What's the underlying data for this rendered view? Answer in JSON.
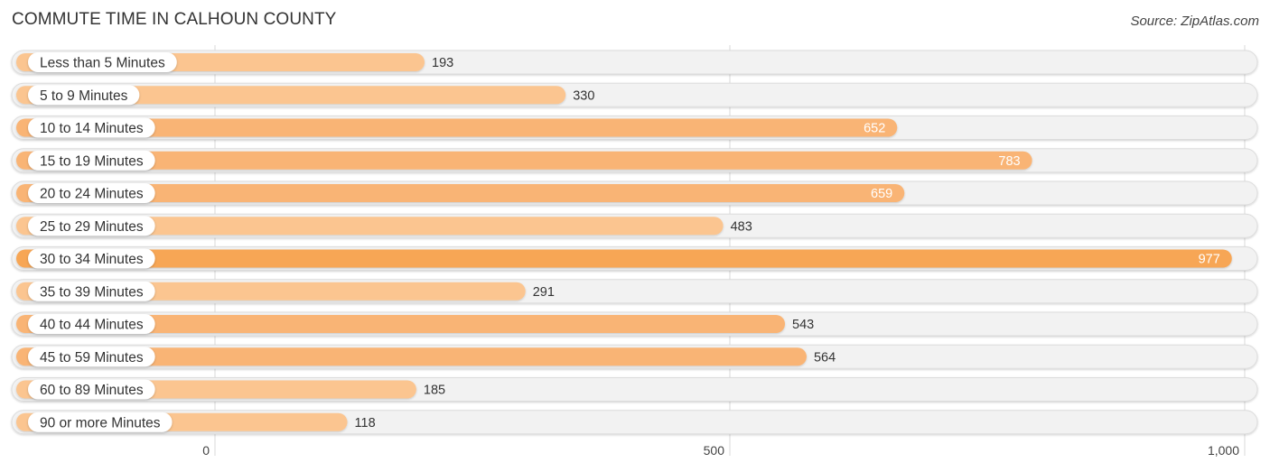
{
  "header": {
    "title": "COMMUTE TIME IN CALHOUN COUNTY",
    "source": "Source: ZipAtlas.com"
  },
  "colors": {
    "bar_light": "#fbc590",
    "bar_mid": "#f9b474",
    "bar_dark": "#f7a654",
    "track": "#f2f2f2",
    "grid": "#d8d8d8"
  },
  "chart_data": {
    "type": "bar",
    "orientation": "horizontal",
    "title": "COMMUTE TIME IN CALHOUN COUNTY",
    "xlabel": "",
    "ylabel": "",
    "categories": [
      "Less than 5 Minutes",
      "5 to 9 Minutes",
      "10 to 14 Minutes",
      "15 to 19 Minutes",
      "20 to 24 Minutes",
      "25 to 29 Minutes",
      "30 to 34 Minutes",
      "35 to 39 Minutes",
      "40 to 44 Minutes",
      "45 to 59 Minutes",
      "60 to 89 Minutes",
      "90 or more Minutes"
    ],
    "values": [
      193,
      330,
      652,
      783,
      659,
      483,
      977,
      291,
      543,
      564,
      185,
      118
    ],
    "value_labels": [
      "193",
      "330",
      "652",
      "783",
      "659",
      "483",
      "977",
      "291",
      "543",
      "564",
      "185",
      "118"
    ],
    "xlim": [
      0,
      1000
    ],
    "ticks": [
      0,
      500,
      1000
    ],
    "tick_labels": [
      "0",
      "500",
      "1,000"
    ],
    "grid": true,
    "legend": "none"
  }
}
